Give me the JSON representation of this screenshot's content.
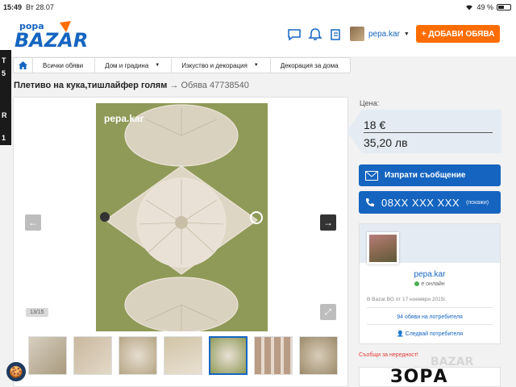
{
  "statusbar": {
    "time": "15:49",
    "date": "Вт 28.07",
    "battery": "49 %",
    "battery_level": 0.49
  },
  "header": {
    "logo_text": "BAZAR",
    "logo_sub": "рора",
    "user_name": "pepa.kar",
    "add_button": "+ ДОБАВИ ОБЯВА"
  },
  "side_ad": {
    "lines": [
      "T",
      "5",
      "R",
      "1"
    ]
  },
  "breadcrumb": {
    "items": [
      {
        "label": "Всички обяви",
        "dropdown": false
      },
      {
        "label": "Дом и градина",
        "dropdown": true
      },
      {
        "label": "Изкуство и декорация",
        "dropdown": true
      },
      {
        "label": "Декорация за дома",
        "dropdown": false
      }
    ]
  },
  "listing": {
    "title": "Плетиво на кука,тишлайфер голям",
    "arrow": "→",
    "ad_id": "Обява 47738540"
  },
  "gallery": {
    "watermark": "pepa.kar",
    "counter": "13/15",
    "image_colors": [
      "#8f9a58",
      "#e9e1d6"
    ],
    "thumb_count": 7,
    "active_thumb": 4
  },
  "price": {
    "label": "Цена:",
    "eur": "18 €",
    "bgn": "35,20 лв"
  },
  "contact": {
    "message_button": "Изпрати съобщение",
    "phone_number": "08XX XXX XXX",
    "phone_show": "(покажи)"
  },
  "seller": {
    "name": "pepa.kar",
    "status": "е онлайн",
    "since": "В Bazar.BG от 17 ноември 2015г.",
    "ads_link": "94 обяви на потребителя",
    "follow_link": "Следвай потребителя"
  },
  "report_link": "Съобщи за нередност!",
  "promo": {
    "brand": "ЗОРА",
    "bazar_mark": "BAZAR"
  },
  "colors": {
    "accent": "#1565c0",
    "orange": "#ff6d00",
    "price_bg": "#e4ebf3"
  }
}
